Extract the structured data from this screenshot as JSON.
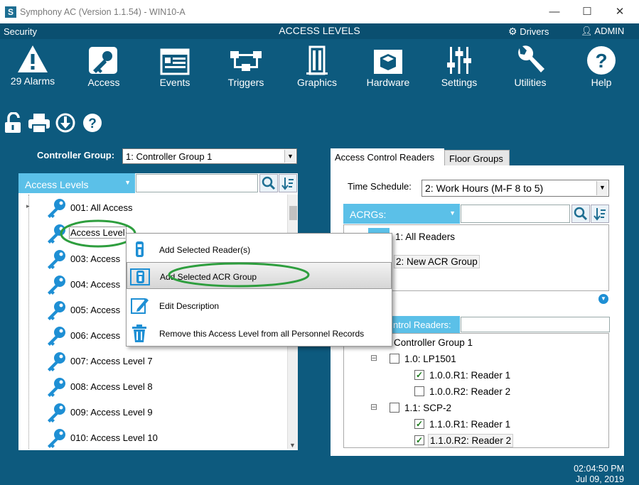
{
  "window": {
    "title": "Symphony AC  (Version 1.1.54) - WIN10-A",
    "logo_letter": "S",
    "minimize": "—",
    "maximize": "☐",
    "close": "✕"
  },
  "topbar": {
    "module": "Security",
    "page_title": "ACCESS LEVELS",
    "drivers_label": "Drivers",
    "user_label": "ADMIN"
  },
  "nav": {
    "items": [
      {
        "label": "29 Alarms",
        "icon": "alarm-warning-icon"
      },
      {
        "label": "Access",
        "icon": "key-icon"
      },
      {
        "label": "Events",
        "icon": "events-list-icon"
      },
      {
        "label": "Triggers",
        "icon": "triggers-network-icon"
      },
      {
        "label": "Graphics",
        "icon": "building-icon"
      },
      {
        "label": "Hardware",
        "icon": "hardware-board-icon"
      },
      {
        "label": "Settings",
        "icon": "sliders-icon"
      },
      {
        "label": "Utilities",
        "icon": "wrench-icon"
      },
      {
        "label": "Help",
        "icon": "help-icon"
      }
    ]
  },
  "controller_group": {
    "label": "Controller Group:",
    "value": "1:  Controller Group 1"
  },
  "access_levels": {
    "header": "Access Levels",
    "search_value": "",
    "items": [
      "001: All Access",
      "Access Level",
      "003: Access",
      "004: Access",
      "005: Access",
      "006: Access",
      "007: Access Level 7",
      "008: Access Level 8",
      "009: Access Level 9",
      "010: Access Level 10"
    ]
  },
  "context_menu": {
    "items": [
      "Add Selected Reader(s)",
      "Add Selected ACR Group",
      "Edit Description",
      "Remove this Access Level from all Personnel Records"
    ],
    "highlight_color": "#2e9e3e"
  },
  "right_tabs": {
    "tab1": "Access Control Readers",
    "tab2": "Floor Groups"
  },
  "time_schedule": {
    "label": "Time Schedule:",
    "value": "2:  Work Hours (M-F 8 to 5)"
  },
  "acrgs": {
    "header": "ACRGs:",
    "search_value": "",
    "items": [
      "1: All Readers",
      "2: New ACR Group"
    ]
  },
  "readers": {
    "header": "ntrol Readers:",
    "group": "Controller Group 1",
    "panels": [
      {
        "label": "1.0:  LP1501",
        "collapse": "⊟",
        "readers": [
          {
            "label": "1.0.0.R1: Reader 1",
            "checked": true
          },
          {
            "label": "1.0.0.R2: Reader 2",
            "checked": false
          }
        ]
      },
      {
        "label": "1.1:  SCP-2",
        "collapse": "⊟",
        "readers": [
          {
            "label": "1.1.0.R1: Reader 1",
            "checked": true
          },
          {
            "label": "1.1.0.R2: Reader 2",
            "checked": true
          }
        ]
      }
    ]
  },
  "clock": {
    "time": "02:04:50 PM",
    "date": "Jul 09, 2019"
  },
  "colors": {
    "background": "#0d5a7e",
    "accent": "#5bc0e8",
    "brand": "#1d6e92"
  }
}
